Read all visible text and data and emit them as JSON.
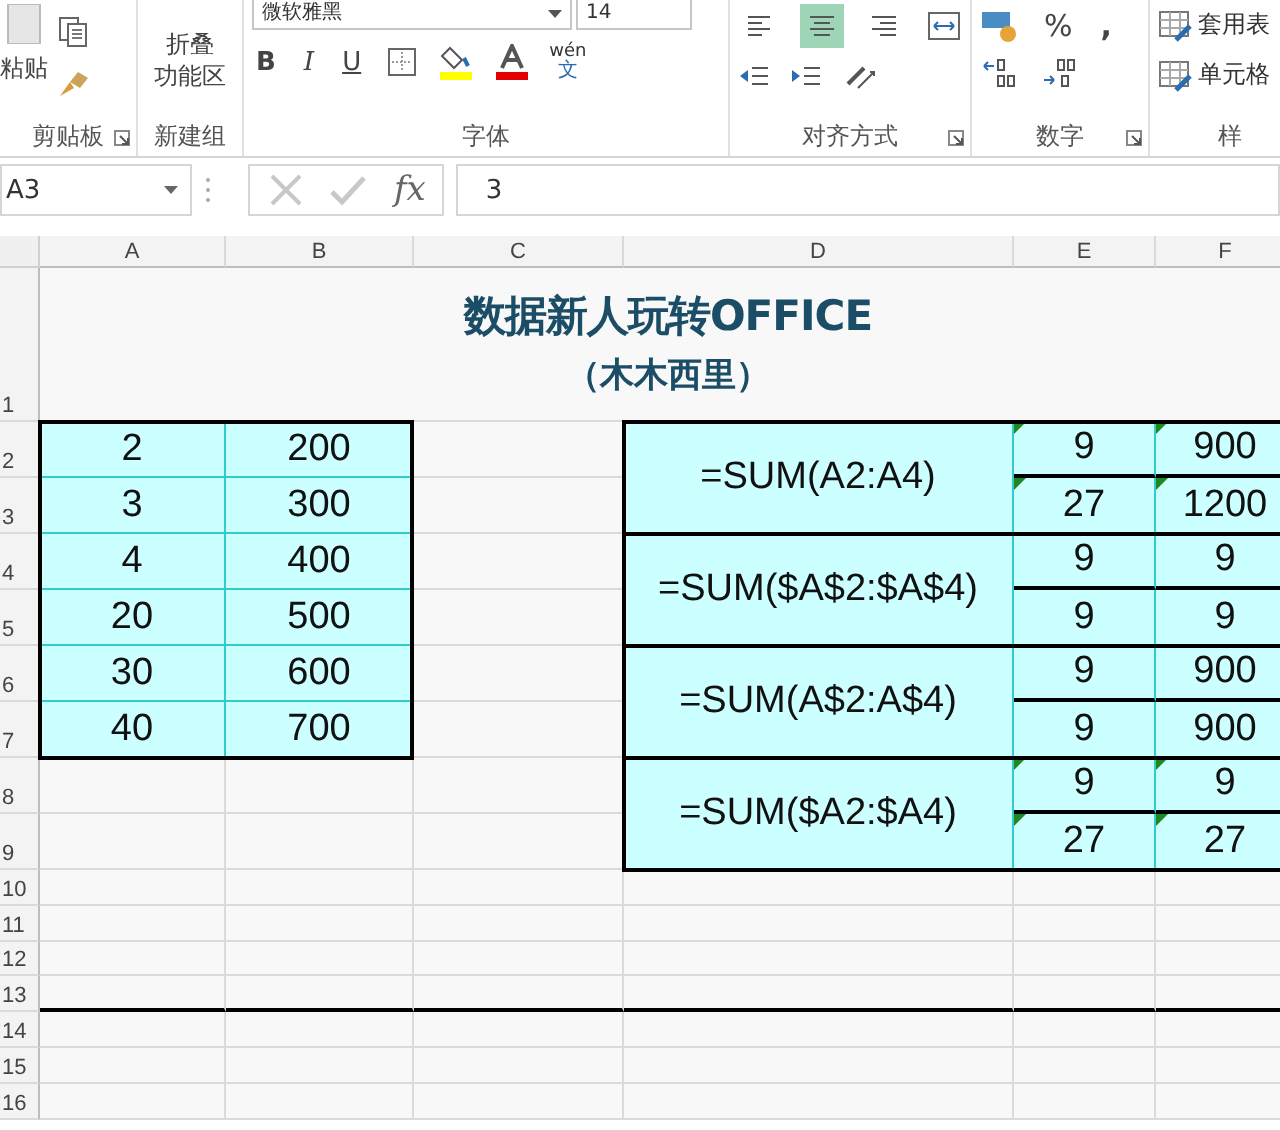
{
  "ribbon": {
    "clipboard": {
      "paste_label": "粘贴",
      "group_label": "剪贴板"
    },
    "new_group": {
      "collapse_lines": [
        "折叠",
        "功能区"
      ],
      "group_label": "新建组"
    },
    "font": {
      "name": "微软雅黑",
      "size": "14",
      "bold": "B",
      "italic": "I",
      "underline": "U",
      "phonetic_top": "wén",
      "phonetic_char": "文",
      "group_label": "字体"
    },
    "alignment": {
      "buttons": [
        {
          "kind": "left",
          "selected": false
        },
        {
          "kind": "center",
          "selected": true
        },
        {
          "kind": "right",
          "selected": false
        }
      ],
      "group_label": "对齐方式"
    },
    "number": {
      "percent": "%",
      "comma": ",",
      "group_label": "数字"
    },
    "styles": {
      "items": [
        "套用表",
        "单元格"
      ],
      "group_label": "样"
    }
  },
  "formula_bar": {
    "name_box": "A3",
    "fx": "fx",
    "value": "3"
  },
  "sheet": {
    "columns": [
      "A",
      "B",
      "C",
      "D",
      "E",
      "F"
    ],
    "rows": [
      "1",
      "2",
      "3",
      "4",
      "5",
      "6",
      "7",
      "8",
      "9",
      "10",
      "11",
      "12",
      "13",
      "14",
      "15",
      "16"
    ],
    "title": "数据新人玩转OFFICE",
    "subtitle": "（木木西里）",
    "left_table": [
      {
        "a": "2",
        "b": "200"
      },
      {
        "a": "3",
        "b": "300"
      },
      {
        "a": "4",
        "b": "400"
      },
      {
        "a": "20",
        "b": "500"
      },
      {
        "a": "30",
        "b": "600"
      },
      {
        "a": "40",
        "b": "700"
      }
    ],
    "right_table": [
      {
        "formula": "=SUM(A2:A4)",
        "rows": [
          {
            "e": "9",
            "f": "900",
            "error_mark": true
          },
          {
            "e": "27",
            "f": "1200",
            "error_mark": true
          }
        ]
      },
      {
        "formula": "=SUM($A$2:$A$4)",
        "rows": [
          {
            "e": "9",
            "f": "9",
            "error_mark": false
          },
          {
            "e": "9",
            "f": "9",
            "error_mark": false
          }
        ]
      },
      {
        "formula": "=SUM(A$2:A$4)",
        "rows": [
          {
            "e": "9",
            "f": "900",
            "error_mark": false
          },
          {
            "e": "9",
            "f": "900",
            "error_mark": false
          }
        ]
      },
      {
        "formula": "=SUM($A2:$A4)",
        "rows": [
          {
            "e": "9",
            "f": "9",
            "error_mark": true
          },
          {
            "e": "27",
            "f": "27",
            "error_mark": true
          }
        ]
      }
    ]
  }
}
